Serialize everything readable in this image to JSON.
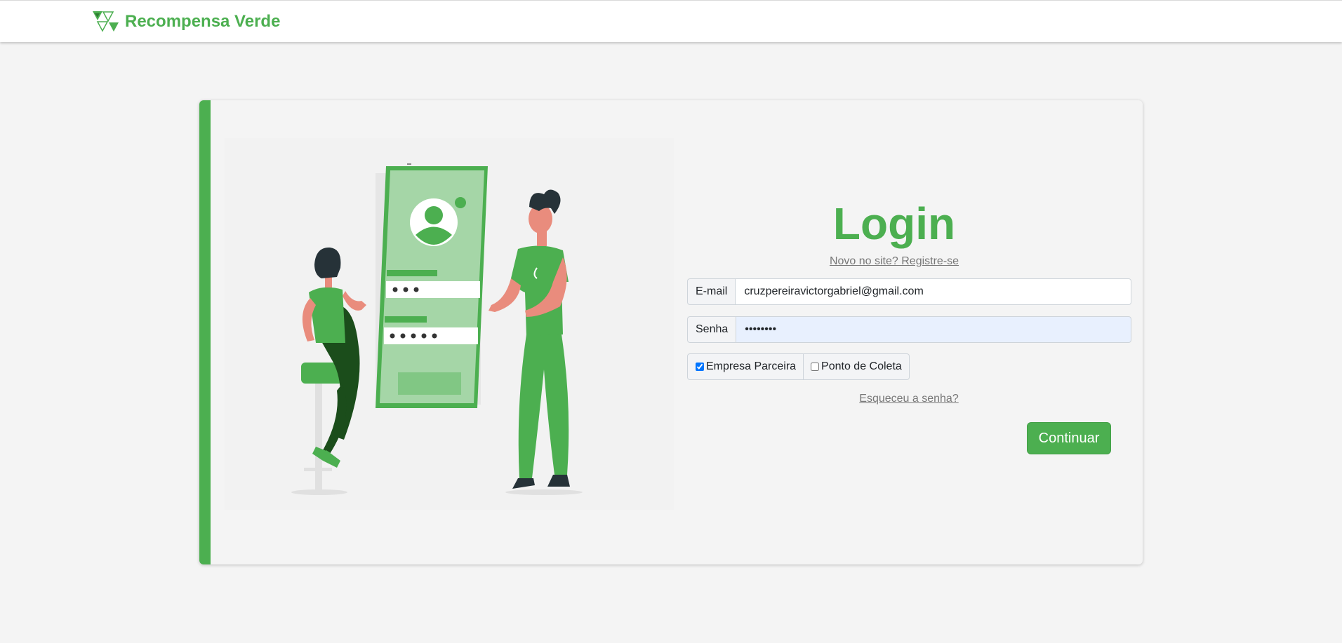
{
  "navbar": {
    "brand_name": "Recompensa Verde",
    "brand_color": "#4caf50",
    "logo_icon": "triangle-mosaic-logo-icon"
  },
  "login": {
    "title": "Login",
    "register_link": "Novo no site? Registre-se",
    "email": {
      "label": "E-mail",
      "value": "cruzpereiravictorgabriel@gmail.com"
    },
    "password": {
      "label": "Senha",
      "value": "••••••••"
    },
    "account_type": {
      "options": [
        {
          "label": "Empresa Parceira",
          "checked": true
        },
        {
          "label": "Ponto de Coleta",
          "checked": false
        }
      ]
    },
    "forgot_link": "Esqueceu a senha?",
    "submit_label": "Continuar"
  },
  "illustration": {
    "icon": "login-illustration-icon",
    "accent_color": "#4caf50"
  }
}
